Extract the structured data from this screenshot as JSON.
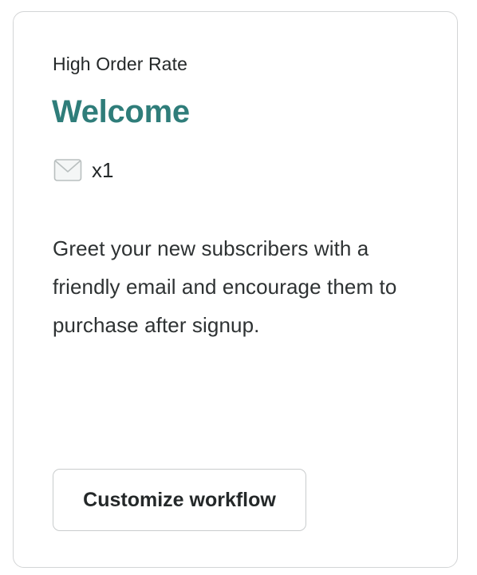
{
  "card": {
    "eyebrow": "High Order Rate",
    "title": "Welcome",
    "email_count": "x1",
    "email_icon": "mail-envelope-icon",
    "description": "Greet your new subscribers with a friendly email and encourage them to purchase after signup.",
    "cta_label": "Customize workflow",
    "accent_color": "#2f7d7a"
  }
}
